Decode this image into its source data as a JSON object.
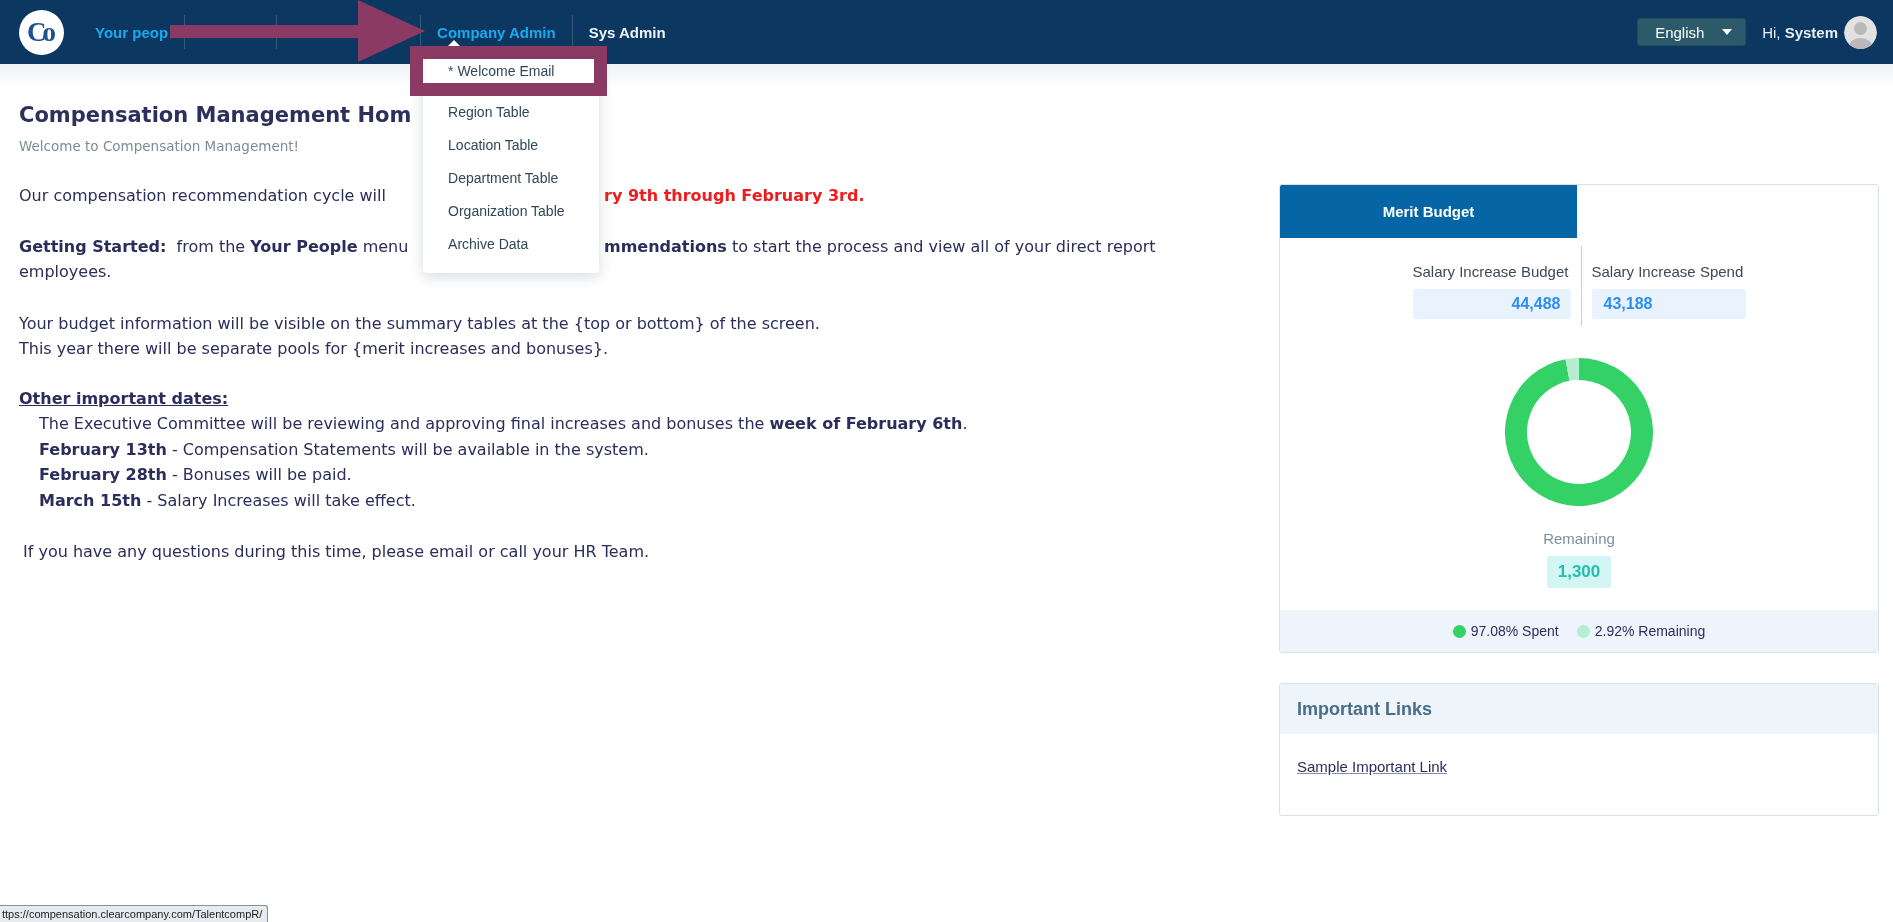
{
  "nav": {
    "logo": "Co",
    "items": [
      {
        "label": "Your peop",
        "active": true,
        "expanded": false
      },
      {
        "label": "Company Admin",
        "active": true,
        "expanded": true,
        "menu": [
          {
            "label": "* Welcome Email",
            "highlighted": true
          },
          {
            "label": "Region Table",
            "highlighted": false
          },
          {
            "label": "Location Table",
            "highlighted": false
          },
          {
            "label": "Department Table",
            "highlighted": false
          },
          {
            "label": "Organization Table",
            "highlighted": false
          },
          {
            "label": "Archive Data",
            "highlighted": false
          }
        ]
      },
      {
        "label": "Sys Admin",
        "active": false,
        "expanded": false
      }
    ],
    "language": "English",
    "greeting": "Hi, **System**"
  },
  "page": {
    "title": "Compensation Management Hom",
    "subtitle": "Welcome to Compensation Management!"
  },
  "intro": {
    "before": "Our compensation recommendation cycle will",
    "after": "ry 9th through February 3rd."
  },
  "getting_started": {
    "before": "**Getting Started:**  from the **Your People** menu",
    "after": "**mmendations** to start the process and view all of your direct report",
    "wrap": "employees."
  },
  "budget_notes": [
    "Your budget information will be visible on the summary tables at the {top or bottom} of the screen.",
    "This year there will be separate pools for {merit increases and bonuses}."
  ],
  "dates": {
    "heading": "Other important dates:",
    "items": [
      "The Executive Committee will be reviewing and approving final increases and bonuses the **week of February 6th**.",
      "**February 13th** - Compensation Statements will be available in the system.",
      "**February 28th** - Bonuses will be paid.",
      "**March 15th** - Salary Increases will take effect."
    ]
  },
  "closing": "If you have any questions during this time, please email or call your HR Team.",
  "merit_budget": {
    "tabs": [
      {
        "label": "Merit Budget",
        "selected": true
      }
    ],
    "stats": [
      {
        "label": "Salary Increase Budget",
        "value": "44,488"
      },
      {
        "label": "Salary Increase Spend",
        "value": "43,188"
      }
    ],
    "chart_data": {
      "type": "donut",
      "values": [
        97.08,
        2.92
      ]
    },
    "remaining": {
      "label": "Remaining",
      "value": "1,300"
    },
    "legend": [
      {
        "label": "97.08% Spent",
        "color": "#34d166"
      },
      {
        "label": "2.92% Remaining",
        "color": "#b5efd2"
      }
    ]
  },
  "important_links": {
    "title": "Important Links",
    "links": [
      "Sample Important Link"
    ]
  },
  "status_bar": {
    "url": "ttps://compensation.clearcompany.com/TalentcompR/"
  }
}
